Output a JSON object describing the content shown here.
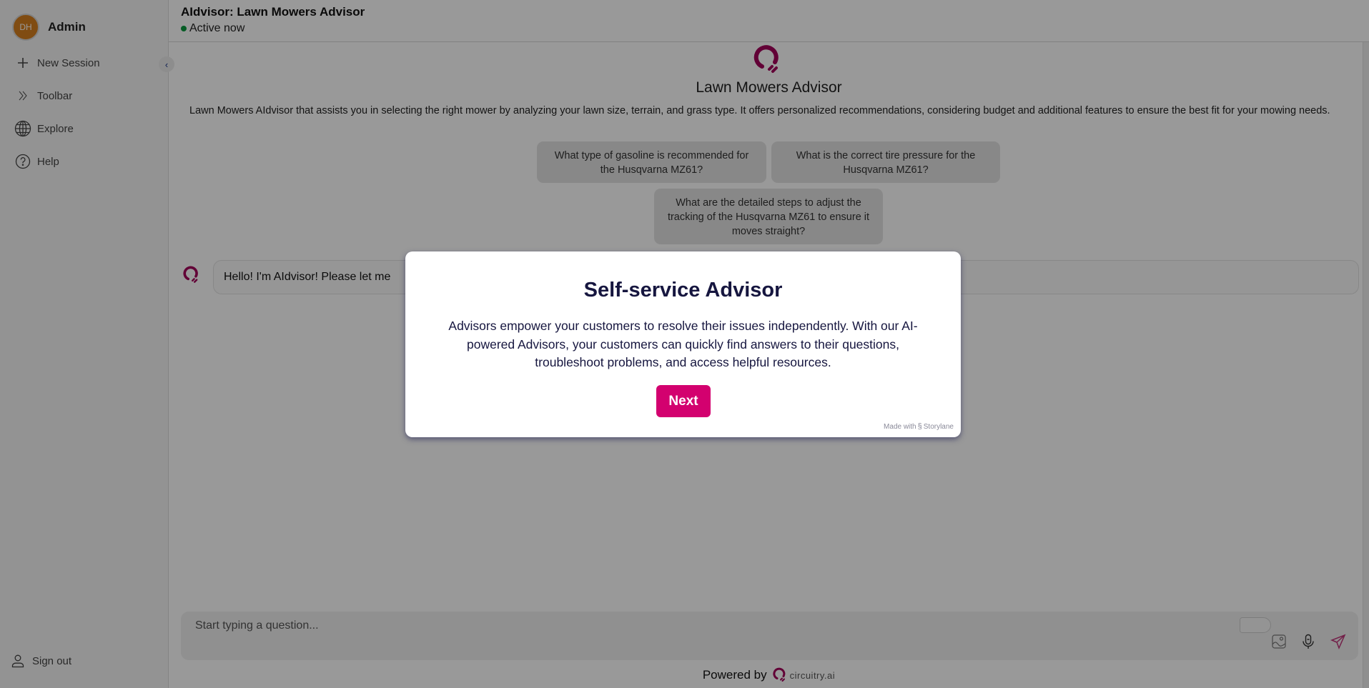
{
  "sidebar": {
    "profile": {
      "initials": "DH",
      "name": "Admin"
    },
    "items": [
      {
        "label": "New Session",
        "icon": "plus-icon"
      },
      {
        "label": "Toolbar",
        "icon": "double-chevron-right-icon"
      },
      {
        "label": "Explore",
        "icon": "globe-icon"
      },
      {
        "label": "Help",
        "icon": "help-circle-icon"
      }
    ],
    "collapse_icon": "‹",
    "signout": {
      "label": "Sign out",
      "icon": "user-icon"
    }
  },
  "header": {
    "title": "AIdvisor: Lawn Mowers Advisor",
    "status": "Active now"
  },
  "main": {
    "advisor_name": "Lawn Mowers Advisor",
    "description": "Lawn Mowers AIdvisor that assists you in selecting the right mower by analyzing your lawn size, terrain, and grass type. It offers personalized recommendations, considering budget and additional features to ensure the best fit for your mowing needs.",
    "suggestions": [
      "What type of gasoline is recommended for the Husqvarna MZ61?",
      "What is the correct tire pressure for the Husqvarna MZ61?",
      "What are the detailed steps to adjust the tracking of the Husqvarna MZ61 to ensure it moves straight?"
    ],
    "messages": [
      {
        "from": "bot",
        "text": "Hello! I'm AIdvisor! Please let me"
      }
    ]
  },
  "input": {
    "placeholder": "Start typing a question...",
    "value": ""
  },
  "footer": {
    "powered_by": "Powered by",
    "brand": "circuitry.ai"
  },
  "modal": {
    "title": "Self-service Advisor",
    "body": "Advisors empower your customers to resolve their issues independently. With our AI-powered Advisors, your customers can quickly find answers to their questions, troubleshoot problems, and access helpful resources.",
    "next_label": "Next",
    "made_with": "Made with",
    "made_with_brand": "Storylane"
  },
  "colors": {
    "brand": "#a3005a",
    "next_button": "#d3016f",
    "status_active": "#0a9a3f",
    "modal_text": "#16163f"
  }
}
